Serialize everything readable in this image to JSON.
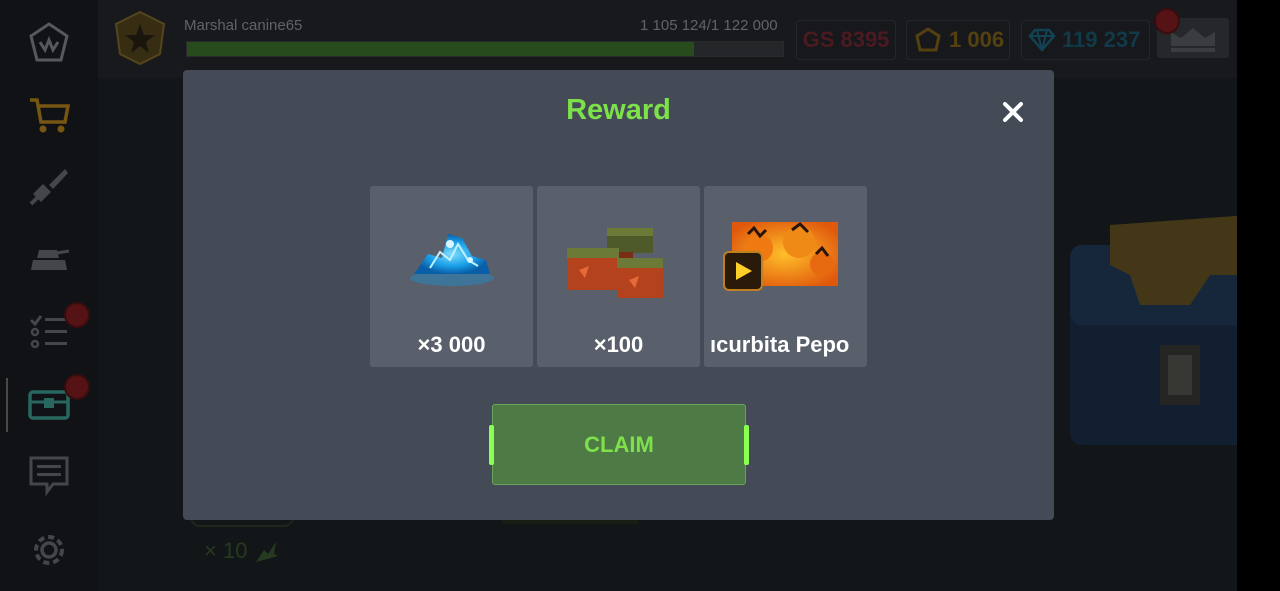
{
  "player": {
    "name": "Marshal  canine65",
    "xp_text": "1 105 124/1 122 000",
    "xp_progress": 0.85
  },
  "currency": {
    "gear_score": "GS 8395",
    "coins": "1 006",
    "gems": "119 237"
  },
  "sidebar": {
    "items": [
      {
        "icon": "home-crown-icon"
      },
      {
        "icon": "shop-cart-icon"
      },
      {
        "icon": "weapon-icon"
      },
      {
        "icon": "tank-icon"
      },
      {
        "icon": "missions-list-icon",
        "notification": true
      },
      {
        "icon": "treasure-chest-icon",
        "notification": true,
        "active": true
      },
      {
        "icon": "chat-icon"
      },
      {
        "icon": "settings-gear-icon"
      }
    ]
  },
  "background": {
    "multiplier_text": "× 10"
  },
  "modal": {
    "title": "Reward",
    "rewards": [
      {
        "icon": "blue-crystals-icon",
        "label": "×3 000"
      },
      {
        "icon": "ammo-crates-icon",
        "label": "×100"
      },
      {
        "icon": "pumpkin-skin-icon",
        "label": "ıcurbita Pepo"
      }
    ],
    "claim_label": "CLAIM"
  },
  "colors": {
    "accent_green": "#7de14a",
    "modal_bg": "#444b56",
    "card_bg": "#59606b",
    "claim_bg": "#4d7a45"
  }
}
